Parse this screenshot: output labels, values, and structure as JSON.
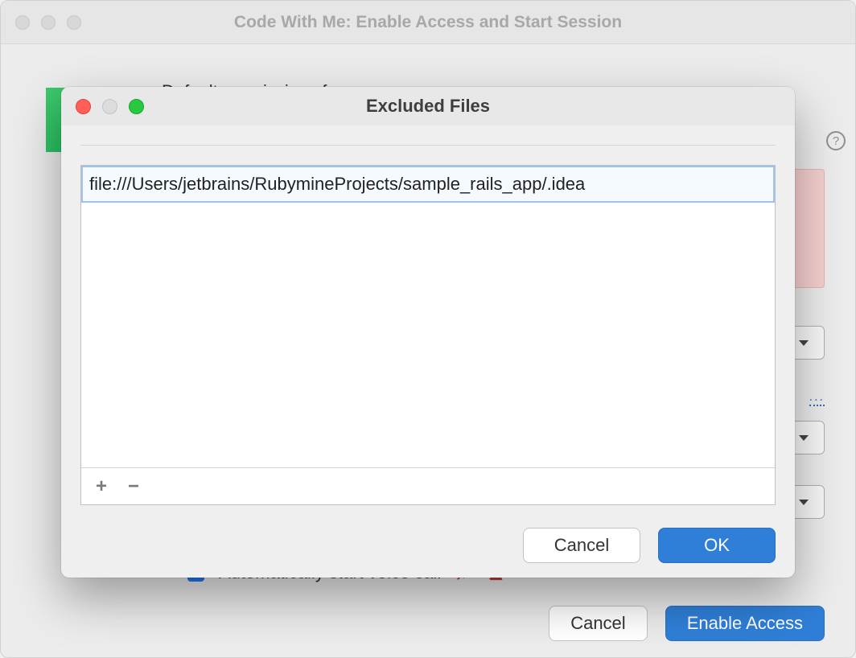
{
  "parent": {
    "title": "Code With Me: Enable Access and Start Session",
    "permissions_heading": "Default permissions for users:",
    "checkbox_label": "Automatically start voice call",
    "cancel": "Cancel",
    "enable": "Enable Access",
    "more": "..."
  },
  "modal": {
    "title": "Excluded Files",
    "items": [
      "file:///Users/jetbrains/RubymineProjects/sample_rails_app/.idea"
    ],
    "add": "+",
    "remove": "−",
    "cancel": "Cancel",
    "ok": "OK"
  }
}
